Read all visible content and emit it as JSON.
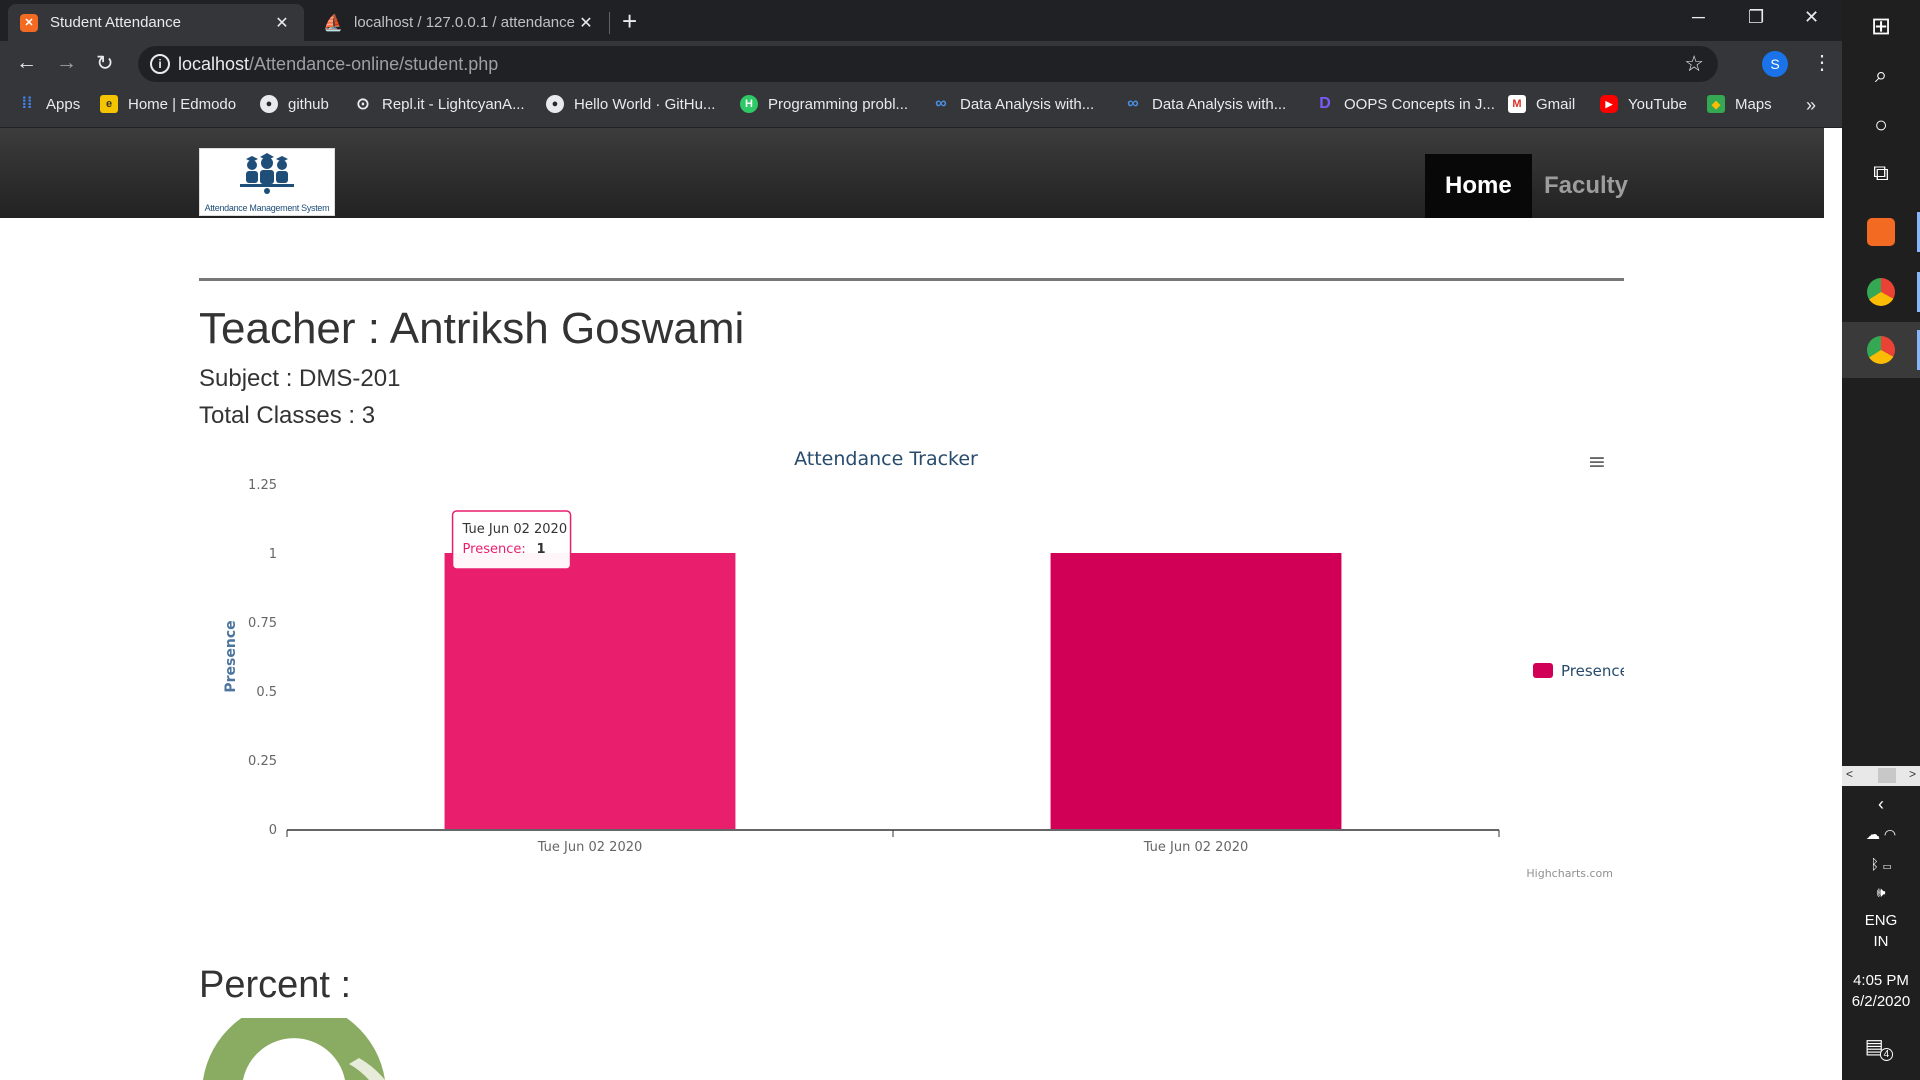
{
  "browser": {
    "tabs": [
      {
        "title": "Student Attendance",
        "active": true
      },
      {
        "title": "localhost / 127.0.0.1 / attendance",
        "active": false
      }
    ],
    "new_tab": "+",
    "url_host": "localhost",
    "url_path": "/Attendance-online/student.php",
    "profile_initial": "S",
    "bookmarks": [
      {
        "label": "Apps",
        "icon": "apps-grid-icon"
      },
      {
        "label": "Home | Edmodo",
        "icon": "edmodo-icon"
      },
      {
        "label": "github",
        "icon": "github-icon"
      },
      {
        "label": "Repl.it - LightcyanA...",
        "icon": "replit-icon"
      },
      {
        "label": "Hello World · GitHu...",
        "icon": "github-icon"
      },
      {
        "label": "Programming probl...",
        "icon": "hackerearth-icon"
      },
      {
        "label": "Data Analysis with...",
        "icon": "coursera-icon"
      },
      {
        "label": "Data Analysis with...",
        "icon": "coursera-icon"
      },
      {
        "label": "OOPS Concepts in J...",
        "icon": "d-logo-icon"
      },
      {
        "label": "Gmail",
        "icon": "gmail-icon"
      },
      {
        "label": "YouTube",
        "icon": "youtube-icon"
      },
      {
        "label": "Maps",
        "icon": "maps-icon"
      }
    ],
    "bookmarks_more": "»"
  },
  "site": {
    "logo_caption": "Attendance Management System",
    "nav": [
      {
        "label": "Home",
        "active": true
      },
      {
        "label": "Faculty",
        "active": false
      }
    ]
  },
  "content": {
    "teacher": "Teacher : Antriksh Goswami",
    "subject": "Subject : DMS-201",
    "total_classes": "Total Classes : 3",
    "percent_heading": "Percent :"
  },
  "chart_data": {
    "type": "bar",
    "title": "Attendance Tracker",
    "categories": [
      "Tue Jun 02 2020",
      "Tue Jun 02 2020"
    ],
    "series": [
      {
        "name": "Presence",
        "values": [
          1,
          1
        ]
      }
    ],
    "ylabel": "Presence",
    "xlabel": "",
    "ylim": [
      0,
      1.25
    ],
    "yticks": [
      "0",
      "0.25",
      "0.5",
      "0.75",
      "1",
      "1.25"
    ],
    "bar_colors": [
      "#e91e6d",
      "#d10056"
    ],
    "legend": "right",
    "credits": "Highcharts.com",
    "tooltip": {
      "header": "Tue Jun 02 2020",
      "series": "Presence:",
      "value": "1"
    },
    "grid": false
  },
  "taskbar": {
    "lang": "ENG",
    "region": "IN",
    "time": "4:05 PM",
    "date": "6/2/2020",
    "notifications": "4"
  },
  "colors": {
    "accent_blue": "#1a73e8",
    "chrome_dark": "#202124",
    "chrome_toolbar": "#35363a",
    "bar_pink": "#e91e6d",
    "donut_green": "#8aab62"
  }
}
